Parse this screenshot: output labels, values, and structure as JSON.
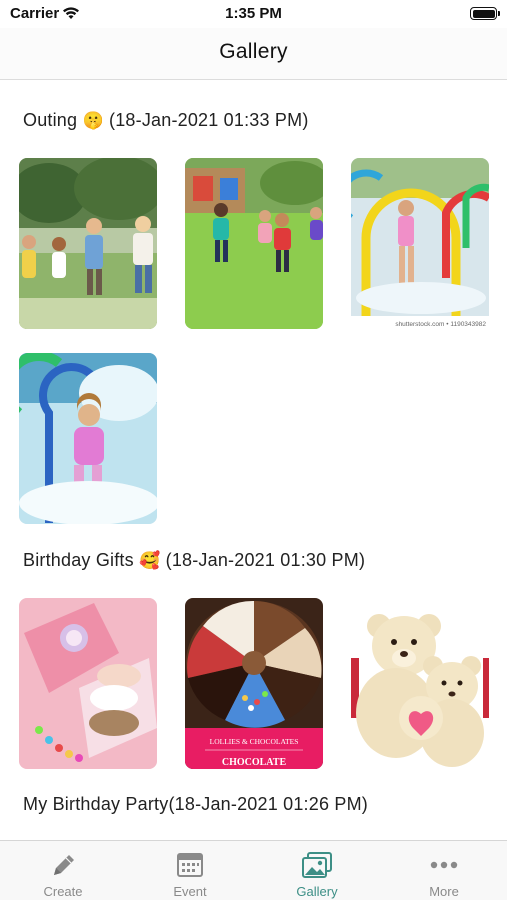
{
  "status_bar": {
    "carrier": "Carrier",
    "time": "1:35 PM"
  },
  "nav": {
    "title": "Gallery"
  },
  "sections": [
    {
      "title": "Outing",
      "emoji": "🤫",
      "timestamp": "(18-Jan-2021 01:33 PM)",
      "photos": [
        "kids-running-park",
        "kids-playground-grass",
        "girl-water-arches",
        "girl-water-splash"
      ],
      "watermark": "shutterstock.com • 1190343982"
    },
    {
      "title": "Birthday Gifts",
      "emoji": "🥰",
      "timestamp": "(18-Jan-2021 01:30 PM)",
      "photos": [
        "pink-hair-bow-gift-box",
        "chocolate-platter",
        "teddy-bears"
      ],
      "chocolate_box_text": [
        "LOLLIES & CHOCOLATES",
        "CHOCOLATE"
      ]
    },
    {
      "title": "My Birthday Party",
      "emoji": "",
      "timestamp": "(18-Jan-2021 01:26 PM)",
      "photos": []
    }
  ],
  "tabs": [
    {
      "label": "Create",
      "icon": "pencil-icon",
      "active": false
    },
    {
      "label": "Event",
      "icon": "calendar-icon",
      "active": false
    },
    {
      "label": "Gallery",
      "icon": "gallery-icon",
      "active": true
    },
    {
      "label": "More",
      "icon": "more-dots-icon",
      "active": false
    }
  ],
  "colors": {
    "accent": "#3d8f86",
    "inactive_tab": "#8a8a8a",
    "tab_bar_bg": "#f8f8f8"
  }
}
